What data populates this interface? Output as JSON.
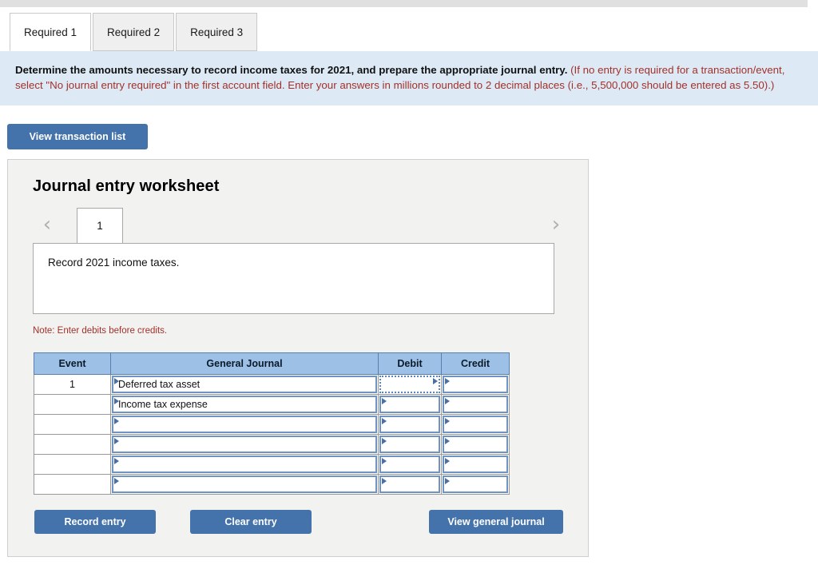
{
  "tabs": [
    {
      "label": "Required 1",
      "active": true
    },
    {
      "label": "Required 2",
      "active": false
    },
    {
      "label": "Required 3",
      "active": false
    }
  ],
  "instructions": {
    "main": "Determine the amounts necessary to record income taxes for 2021, and prepare the appropriate journal entry.",
    "hint": "(If no entry is required for a transaction/event, select \"No journal entry required\" in the first account field. Enter your answers in millions rounded to 2 decimal places (i.e., 5,500,000 should be entered as 5.50).)"
  },
  "toolbar": {
    "view_transaction_list": "View transaction list"
  },
  "worksheet": {
    "title": "Journal entry worksheet",
    "prev_arrow": "‹",
    "next_arrow": "›",
    "page_number": "1",
    "description": "Record 2021 income taxes.",
    "note": "Note: Enter debits before credits.",
    "columns": [
      "Event",
      "General Journal",
      "Debit",
      "Credit"
    ],
    "rows": [
      {
        "event": "1",
        "general_journal": "Deferred tax asset",
        "debit": "",
        "credit": "",
        "debit_selected": true
      },
      {
        "event": "",
        "general_journal": "Income tax expense",
        "debit": "",
        "credit": "",
        "debit_selected": false
      },
      {
        "event": "",
        "general_journal": "",
        "debit": "",
        "credit": "",
        "debit_selected": false
      },
      {
        "event": "",
        "general_journal": "",
        "debit": "",
        "credit": "",
        "debit_selected": false
      },
      {
        "event": "",
        "general_journal": "",
        "debit": "",
        "credit": "",
        "debit_selected": false
      },
      {
        "event": "",
        "general_journal": "",
        "debit": "",
        "credit": "",
        "debit_selected": false
      }
    ],
    "buttons": {
      "record_entry": "Record entry",
      "clear_entry": "Clear entry",
      "view_general_journal": "View general journal"
    }
  },
  "colors": {
    "accent_blue": "#4472aa",
    "table_header_blue": "#9cc0e6",
    "banner_blue": "#ddeaf6",
    "hint_red": "#a33129"
  }
}
